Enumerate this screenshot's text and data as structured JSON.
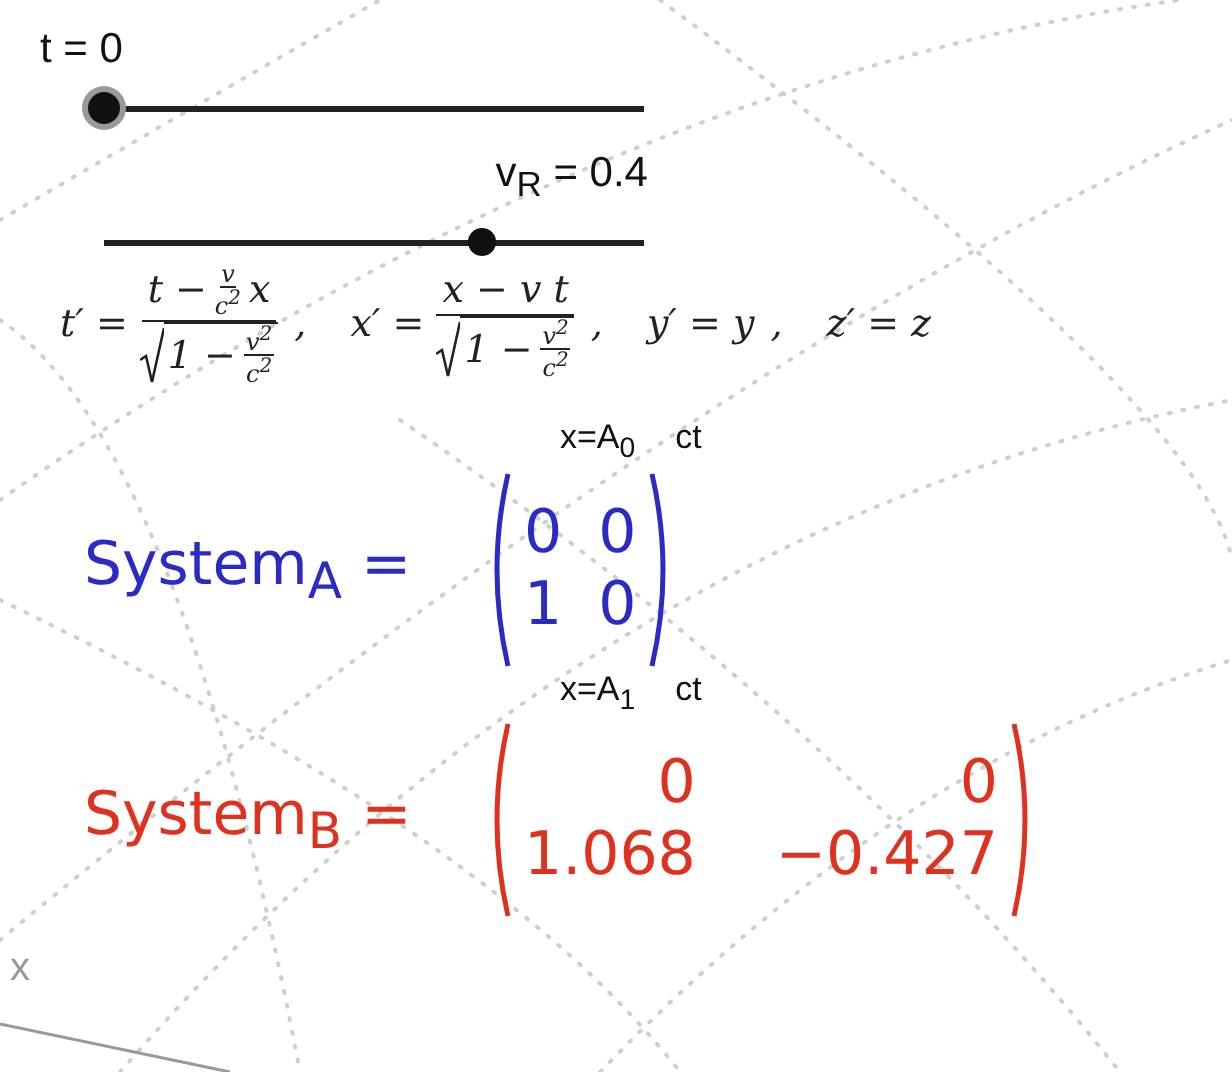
{
  "sliders": [
    {
      "label": "t = 0",
      "level": 0
    },
    {
      "label": "v$_{R}$ = 0.4",
      "level": 0.7
    }
  ],
  "transformations": [
    {
      "kind": "fraction",
      "lhs": "t′ =",
      "numerator": [
        {
          "kind": "text",
          "text": "t −"
        },
        {
          "kind": "frac",
          "top": "v",
          "bottom": "c$^{2}$"
        },
        {
          "kind": "text",
          "text": "x"
        }
      ],
      "denominator": [
        {
          "kind": "text",
          "text": "1 −"
        },
        {
          "kind": "frac",
          "top": "v$^{2}$",
          "bottom": "c$^{2}$"
        }
      ],
      "separator": ","
    },
    {
      "kind": "fraction",
      "lhs": "x′ =",
      "numerator": [
        {
          "kind": "text",
          "text": "x − v t"
        }
      ],
      "denominator": [
        {
          "kind": "text",
          "text": "1 −"
        },
        {
          "kind": "frac",
          "top": "v$^{2}$",
          "bottom": "c$^{2}$"
        }
      ],
      "separator": ","
    },
    {
      "kind": "plain",
      "lhs": "y′ =",
      "rhs": "y",
      "separator": ","
    },
    {
      "kind": "plain",
      "lhs": "z′ =",
      "rhs": "z"
    }
  ],
  "matrices": [
    {
      "name": "System$_{A}$ =",
      "color": "#2a2ac4",
      "column_labels": [
        "x=A$_{0}$",
        "ct"
      ],
      "rows": [
        [
          "0",
          "0"
        ],
        [
          "1",
          "0"
        ]
      ]
    },
    {
      "name": "System$_{B}$ =",
      "color": "#e0301e",
      "column_labels": [
        "x=A$_{1}$",
        "ct"
      ],
      "rows": [
        [
          "0",
          "0"
        ],
        [
          "1.068",
          "−0.427"
        ]
      ]
    }
  ],
  "axis_label": "x"
}
